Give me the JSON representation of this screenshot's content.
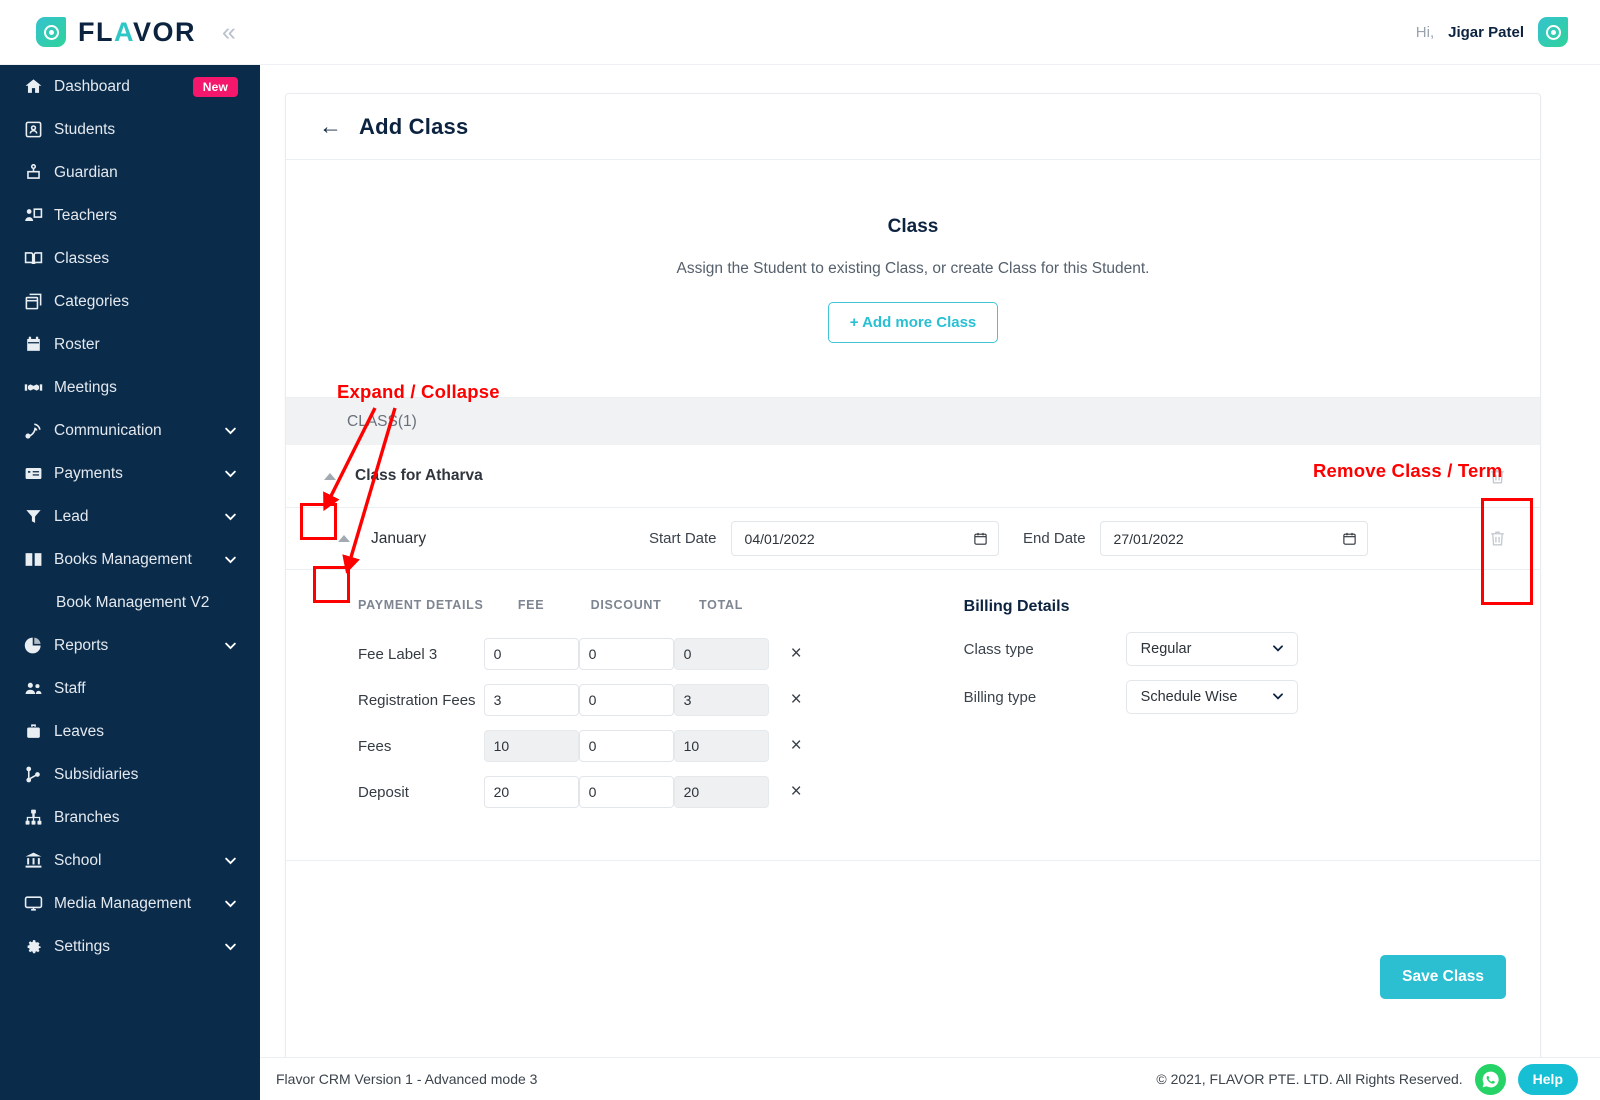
{
  "brand": {
    "name_part1": "FL",
    "name_accent": "A",
    "name_part2": "VOR",
    "collapse_glyph": "«"
  },
  "header": {
    "greeting_prefix": "Hi,",
    "user_name": "Jigar Patel"
  },
  "sidebar": {
    "items": [
      {
        "label": "Dashboard",
        "icon": "home-icon",
        "badge": "New",
        "chevron": false
      },
      {
        "label": "Students",
        "icon": "id-card-icon",
        "chevron": false
      },
      {
        "label": "Guardian",
        "icon": "guardian-icon",
        "chevron": false
      },
      {
        "label": "Teachers",
        "icon": "teacher-icon",
        "chevron": false
      },
      {
        "label": "Classes",
        "icon": "open-book-icon",
        "chevron": false
      },
      {
        "label": "Categories",
        "icon": "boxes-icon",
        "chevron": false
      },
      {
        "label": "Roster",
        "icon": "calendar-icon",
        "chevron": false
      },
      {
        "label": "Meetings",
        "icon": "handshake-icon",
        "chevron": false
      },
      {
        "label": "Communication",
        "icon": "megaphone-icon",
        "chevron": true
      },
      {
        "label": "Payments",
        "icon": "payment-card-icon",
        "chevron": true
      },
      {
        "label": "Lead",
        "icon": "funnel-icon",
        "chevron": true
      },
      {
        "label": "Books Management",
        "icon": "book-icon",
        "chevron": true
      },
      {
        "label": "Book Management V2",
        "icon": "",
        "chevron": false,
        "sub": true
      },
      {
        "label": "Reports",
        "icon": "pie-chart-icon",
        "chevron": true
      },
      {
        "label": "Staff",
        "icon": "people-icon",
        "chevron": false
      },
      {
        "label": "Leaves",
        "icon": "briefcase-icon",
        "chevron": false
      },
      {
        "label": "Subsidiaries",
        "icon": "sitemap-icon",
        "chevron": false
      },
      {
        "label": "Branches",
        "icon": "branches-icon",
        "chevron": false
      },
      {
        "label": "School",
        "icon": "bank-icon",
        "chevron": true
      },
      {
        "label": "Media Management",
        "icon": "monitor-icon",
        "chevron": true
      },
      {
        "label": "Settings",
        "icon": "gear-icon",
        "chevron": true
      }
    ]
  },
  "page": {
    "title": "Add Class",
    "back_icon": "back-arrow-icon",
    "intro_heading": "Class",
    "intro_text": "Assign the Student to existing Class, or create Class for this Student.",
    "add_more_label": "+ Add more Class",
    "class_count_label": "CLASS(1)"
  },
  "class_row": {
    "title": "Class for Atharva",
    "caret": "caret-up",
    "delete_icon": "trash-icon"
  },
  "term_row": {
    "title": "January",
    "start_date_label": "Start Date",
    "start_date_value": "04/01/2022",
    "end_date_label": "End Date",
    "end_date_value": "27/01/2022",
    "calendar_icon": "calendar-icon",
    "delete_icon": "trash-icon"
  },
  "payment": {
    "headers": [
      "PAYMENT DETAILS",
      "FEE",
      "DISCOUNT",
      "TOTAL"
    ],
    "rows": [
      {
        "label": "Fee Label 3",
        "fee": "0",
        "fee_disabled": false,
        "discount": "0",
        "total": "0"
      },
      {
        "label": "Registration Fees",
        "fee": "3",
        "fee_disabled": false,
        "discount": "0",
        "total": "3"
      },
      {
        "label": "Fees",
        "fee": "10",
        "fee_disabled": true,
        "discount": "0",
        "total": "10"
      },
      {
        "label": "Deposit",
        "fee": "20",
        "fee_disabled": false,
        "discount": "0",
        "total": "20"
      }
    ],
    "remove_glyph": "×"
  },
  "billing": {
    "heading": "Billing Details",
    "class_type_label": "Class type",
    "class_type_value": "Regular",
    "billing_type_label": "Billing type",
    "billing_type_value": "Schedule Wise"
  },
  "actions": {
    "save_label": "Save Class"
  },
  "footer": {
    "version": "Flavor CRM Version 1 - Advanced mode 3",
    "copyright": "© 2021, FLAVOR PTE. LTD. All Rights Reserved.",
    "help_label": "Help",
    "whatsapp_icon": "whatsapp-icon"
  },
  "annotations": {
    "expand_collapse": "Expand / Collapse",
    "remove_class_term": "Remove Class / Term",
    "color": "#ff0000"
  }
}
